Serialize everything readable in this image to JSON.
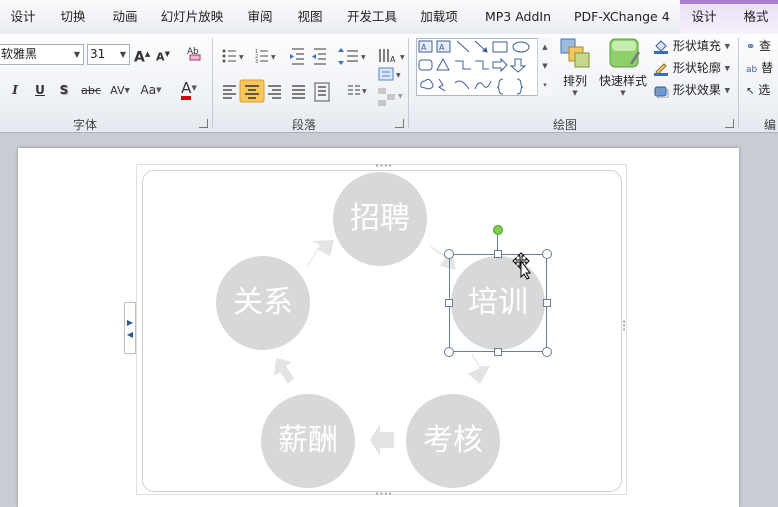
{
  "tabs": [
    "设计",
    "切换",
    "动画",
    "幻灯片放映",
    "审阅",
    "视图",
    "开发工具",
    "加载项",
    "MP3 AddIn",
    "PDF-XChange 4"
  ],
  "context_tabs": [
    "设计",
    "格式"
  ],
  "font": {
    "name": "软雅黑",
    "size": "31",
    "grow_label": "A",
    "shrink_label": "A",
    "italic": "I",
    "underline": "U",
    "shadow": "S",
    "strike": "abc",
    "spacing": "AV",
    "case": "Aa",
    "color_label": "A",
    "group_label": "字体"
  },
  "paragraph": {
    "group_label": "段落"
  },
  "drawing": {
    "arrange_label": "排列",
    "quick_styles_label": "快速样式",
    "shape_fill": "形状填充",
    "shape_outline": "形状轮廓",
    "shape_effects": "形状效果",
    "group_label": "绘图"
  },
  "editing": {
    "find": "查",
    "replace": "替",
    "select": "选",
    "group_label": "编"
  },
  "diagram": {
    "nodes": [
      "招聘",
      "培训",
      "考核",
      "薪酬",
      "关系"
    ],
    "circle_color": "#d8d8d8",
    "arrow_color": "#e4e4e4"
  },
  "colors": {
    "accent_selected": "#f8c55a",
    "context_tab": "#a97fd1",
    "font_color_bar": "#d40000"
  }
}
